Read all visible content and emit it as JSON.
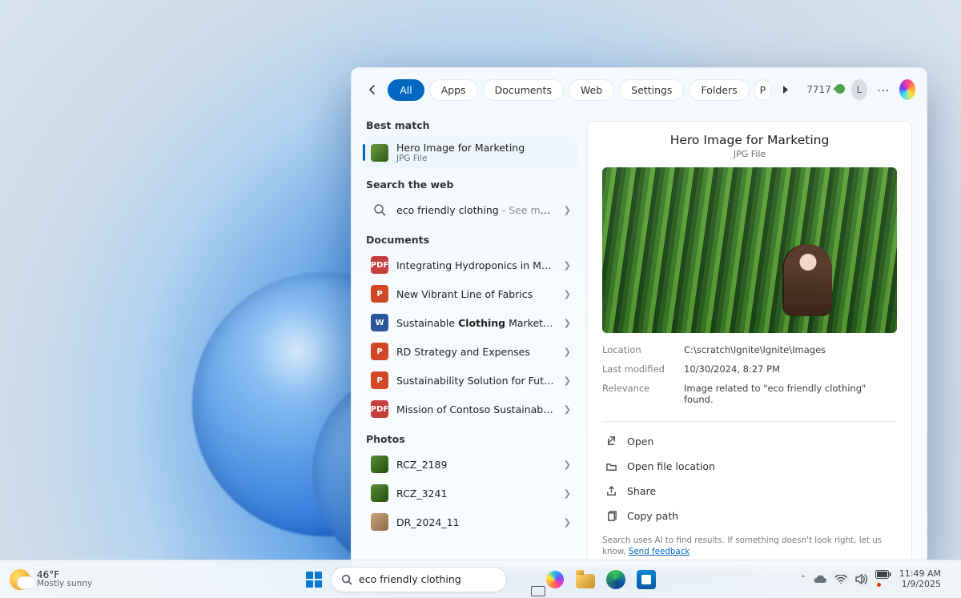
{
  "panel": {
    "filters": {
      "active": "All",
      "items": [
        "All",
        "Apps",
        "Documents",
        "Web",
        "Settings",
        "Folders"
      ],
      "overflow_stub": "P"
    },
    "points": "7717",
    "avatar_initial": "L",
    "sections": {
      "best_match_h": "Best match",
      "best_match": {
        "title": "Hero Image for Marketing",
        "sub": "JPG File"
      },
      "web_h": "Search the web",
      "web": {
        "query": "eco friendly clothing",
        "suffix": " - See more search results"
      },
      "docs_h": "Documents",
      "docs": [
        {
          "icon": "pdf",
          "title": "Integrating Hydroponics in Manu…"
        },
        {
          "icon": "ppt",
          "title": "New Vibrant Line of Fabrics"
        },
        {
          "icon": "word",
          "title_html": "Sustainable <b>Clothing</b> Marketing …"
        },
        {
          "icon": "ppt",
          "title": "RD Strategy and Expenses"
        },
        {
          "icon": "ppt",
          "title": "Sustainability Solution for Future …"
        },
        {
          "icon": "pdf",
          "title": "Mission of Contoso Sustainable F…"
        }
      ],
      "photos_h": "Photos",
      "photos": [
        {
          "title": "RCZ_2189"
        },
        {
          "title": "RCZ_3241"
        },
        {
          "title": "DR_2024_11"
        }
      ]
    },
    "preview": {
      "title": "Hero Image for Marketing",
      "sub": "JPG File",
      "meta": {
        "location_k": "Location",
        "location_v": "C:\\scratch\\Ignite\\Ignite\\Images",
        "modified_k": "Last modified",
        "modified_v": "10/30/2024, 8:27 PM",
        "relevance_k": "Relevance",
        "relevance_v": "Image related to \"eco friendly clothing\" found."
      },
      "actions": {
        "open": "Open",
        "location": "Open file location",
        "share": "Share",
        "copy": "Copy path"
      },
      "ai_note_prefix": "Search uses AI to find results. If something doesn't look right, let us know. ",
      "ai_note_link": "Send feedback"
    }
  },
  "taskbar": {
    "weather": {
      "temp": "46°F",
      "desc": "Mostly sunny"
    },
    "search_value": "eco friendly clothing",
    "clock": {
      "time": "11:49 AM",
      "date": "1/9/2025"
    }
  }
}
